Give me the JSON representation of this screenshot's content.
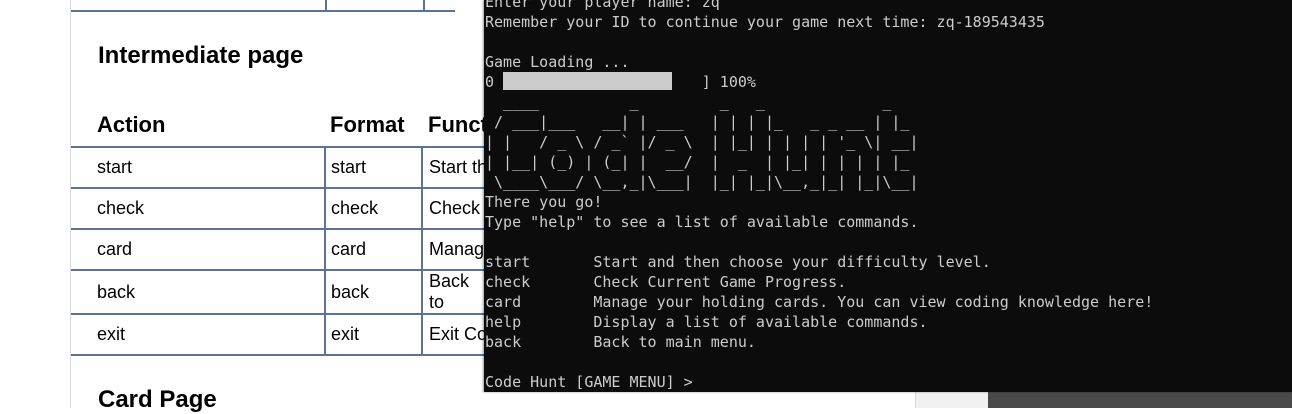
{
  "document": {
    "heading_intermediate": "Intermediate page",
    "heading_card": "Card Page",
    "table": {
      "headers": [
        "Action",
        "Format",
        "Funct"
      ],
      "rows": [
        [
          "start",
          "start",
          "Start th"
        ],
        [
          "check",
          "check",
          "Check"
        ],
        [
          "card",
          "card",
          "Manag"
        ],
        [
          "back",
          "back",
          "Back to"
        ],
        [
          "exit",
          "exit",
          "Exit Co"
        ]
      ]
    }
  },
  "terminal": {
    "lines": [
      "Enter your player name: zq",
      "Remember your ID to continue your game next time: zq-189543435",
      "",
      "Game Loading ...",
      "0                       ] 100%",
      "  ____          _         _   _             _",
      " / ___|___   __| | ___   | | | |_   _ _ __ | |_",
      "| |   / _ \\ / _` |/ _ \\  | |_| | | | | '_ \\| __|",
      "| |__| (_) | (_| |  __/  |  _  | |_| | | | | |_",
      " \\____\\___/ \\__,_|\\___|  |_| |_|\\__,_|_| |_|\\__|",
      "There you go!",
      "Type \"help\" to see a list of available commands.",
      "",
      "start       Start and then choose your difficulty level.",
      "check       Check Current Game Progress.",
      "card        Manage your holding cards. You can view coding knowledge here!",
      "help        Display a list of available commands.",
      "back        Back to main menu.",
      "",
      "Code Hunt [GAME MENU] >"
    ],
    "progress": 1.0
  },
  "colors": {
    "terminal_bg": "#0c0c0c",
    "terminal_text": "#cccccc",
    "table_border": "#5b7399"
  }
}
